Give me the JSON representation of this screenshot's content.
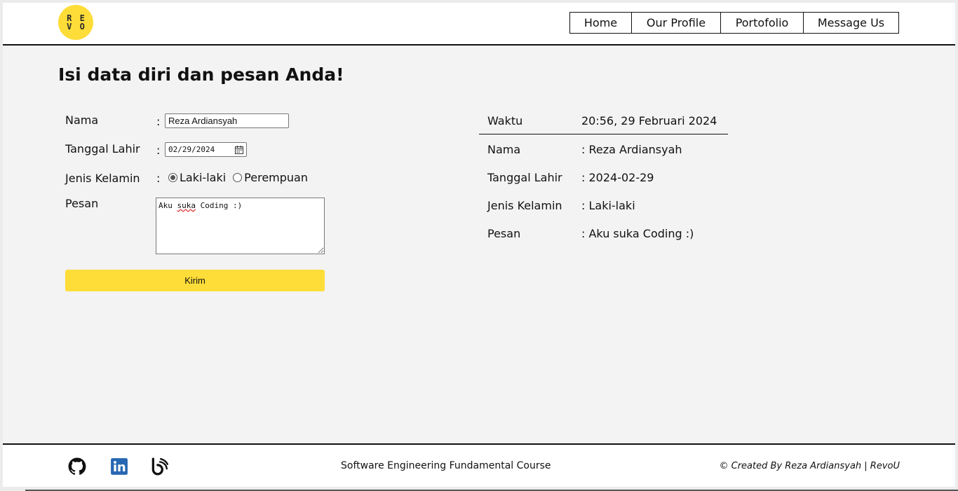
{
  "logo": {
    "line1": "R E",
    "line2": "V O"
  },
  "nav": {
    "items": [
      {
        "label": "Home"
      },
      {
        "label": "Our Profile"
      },
      {
        "label": "Portofolio"
      },
      {
        "label": "Message Us"
      }
    ]
  },
  "page_title": "Isi data diri dan pesan Anda!",
  "form": {
    "colon": ":",
    "name_label": "Nama",
    "name_value": "Reza Ardiansyah",
    "dob_label": "Tanggal Lahir",
    "dob_value": "02/29/2024",
    "gender_label": "Jenis Kelamin",
    "gender_options": [
      {
        "label": "Laki-laki",
        "checked": true
      },
      {
        "label": "Perempuan",
        "checked": false
      }
    ],
    "message_label": "Pesan",
    "message_value_before": "Aku ",
    "message_value_misspelled": "suka",
    "message_value_after": " Coding :)",
    "submit_label": "Kirim"
  },
  "result": {
    "time_label": "Waktu",
    "time_value": "20:56, 29 Februari 2024",
    "name_label": "Nama",
    "name_value": ": Reza Ardiansyah",
    "dob_label": "Tanggal Lahir",
    "dob_value": ": 2024-02-29",
    "gender_label": "Jenis Kelamin",
    "gender_value": ": Laki-laki",
    "message_label": "Pesan",
    "message_value": ": Aku suka Coding :)"
  },
  "footer": {
    "icons": [
      "github-icon",
      "linkedin-icon",
      "behance-icon"
    ],
    "course": "Software Engineering Fundamental Course",
    "credit": "© Created By Reza Ardiansyah | RevoU"
  },
  "colors": {
    "accent": "#fedd39",
    "background": "#f3f3f3",
    "linkedin": "#2867b2"
  }
}
